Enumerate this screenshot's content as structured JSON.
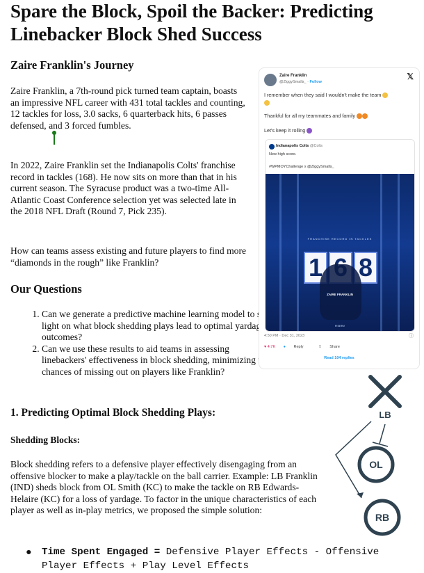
{
  "title": "Spare the Block, Spoil the Backer: Predicting Linebacker Block Shed Success",
  "journey": {
    "heading": "Zaire Franklin's Journey",
    "para1": "Zaire Franklin, a 7th-round pick turned team captain, boasts an impressive NFL career with 431 total tackles and counting, 12 tackles for loss, 3.0 sacks, 6 quarterback hits, 6 passes defensed, and 3 forced fumbles.",
    "para2": "In 2022, Zaire Franklin set the Indianapolis Colts' franchise record in tackles (168). He now sits on more than that in his current season. The Syracuse product was a two-time All-Atlantic Coast Conference selection yet was selected late in the 2018 NFL Draft (Round 7, Pick 235).",
    "para3": "How can teams assess existing and future players to find more “diamonds in the rough” like Franklin?"
  },
  "questions": {
    "heading": "Our Questions",
    "items": [
      "Can we generate a predictive machine learning model to shed light on what block shedding plays lead to optimal yardage outcomes?",
      "Can we use these results to aid teams in assessing linebackers' effectiveness in block shedding, minimizing the chances of missing out on players like Franklin?"
    ]
  },
  "section1": {
    "heading": "1.  Predicting Optimal Block Shedding Plays:",
    "subheading": "Shedding Blocks:",
    "para": "Block shedding refers to a defensive player effectively disengaging from an offensive blocker to make a play/tackle on the ball carrier. Example: LB Franklin (IND) sheds block from OL Smith (KC) to make the tackle on RB Edwards-Helaire (KC) for a loss of yardage. To factor in the unique characteristics of each player as well as in-play metrics, we proposed the simple solution:",
    "bullet_bold": "Time Spent Engaged =",
    "bullet_rest": " Defensive Player Effects - Offensive Player Effects + Play Level Effects"
  },
  "tweet": {
    "name": "Zaire Franklin",
    "handle": "@ZiggySmalls_ ·",
    "follow": "Follow",
    "close": "𝕏",
    "line1": "I remember when they said I wouldn't make the team",
    "line2": "Thankful for all my teammates and family",
    "line3": "Let's keep it rolling",
    "quote_name": "Indianapolis Colts",
    "quote_handle": "@Colts",
    "quote_text1": "New high score.",
    "quote_text2": "#WPMOYChallenge x @ZiggySmalls_",
    "poster_caption": "FRANCHISE RECORD IN TACKLES",
    "digits": [
      "1",
      "6",
      "8"
    ],
    "poster_name": "ZAIRE FRANKLIN",
    "poster_logo": "FISERV",
    "meta": "4:50 PM · Dec 31, 2023",
    "info": "ⓘ",
    "likes": "♥ 4.7K",
    "reply": "Reply",
    "share": "Share",
    "replies": "Read 104 replies",
    "colors": {
      "accent": "#1d9bf0",
      "poster": "#123a8f",
      "like": "#e0245e"
    }
  },
  "diagram": {
    "lb": "LB",
    "ol": "OL",
    "rb": "RB",
    "color": "#2f4250"
  }
}
